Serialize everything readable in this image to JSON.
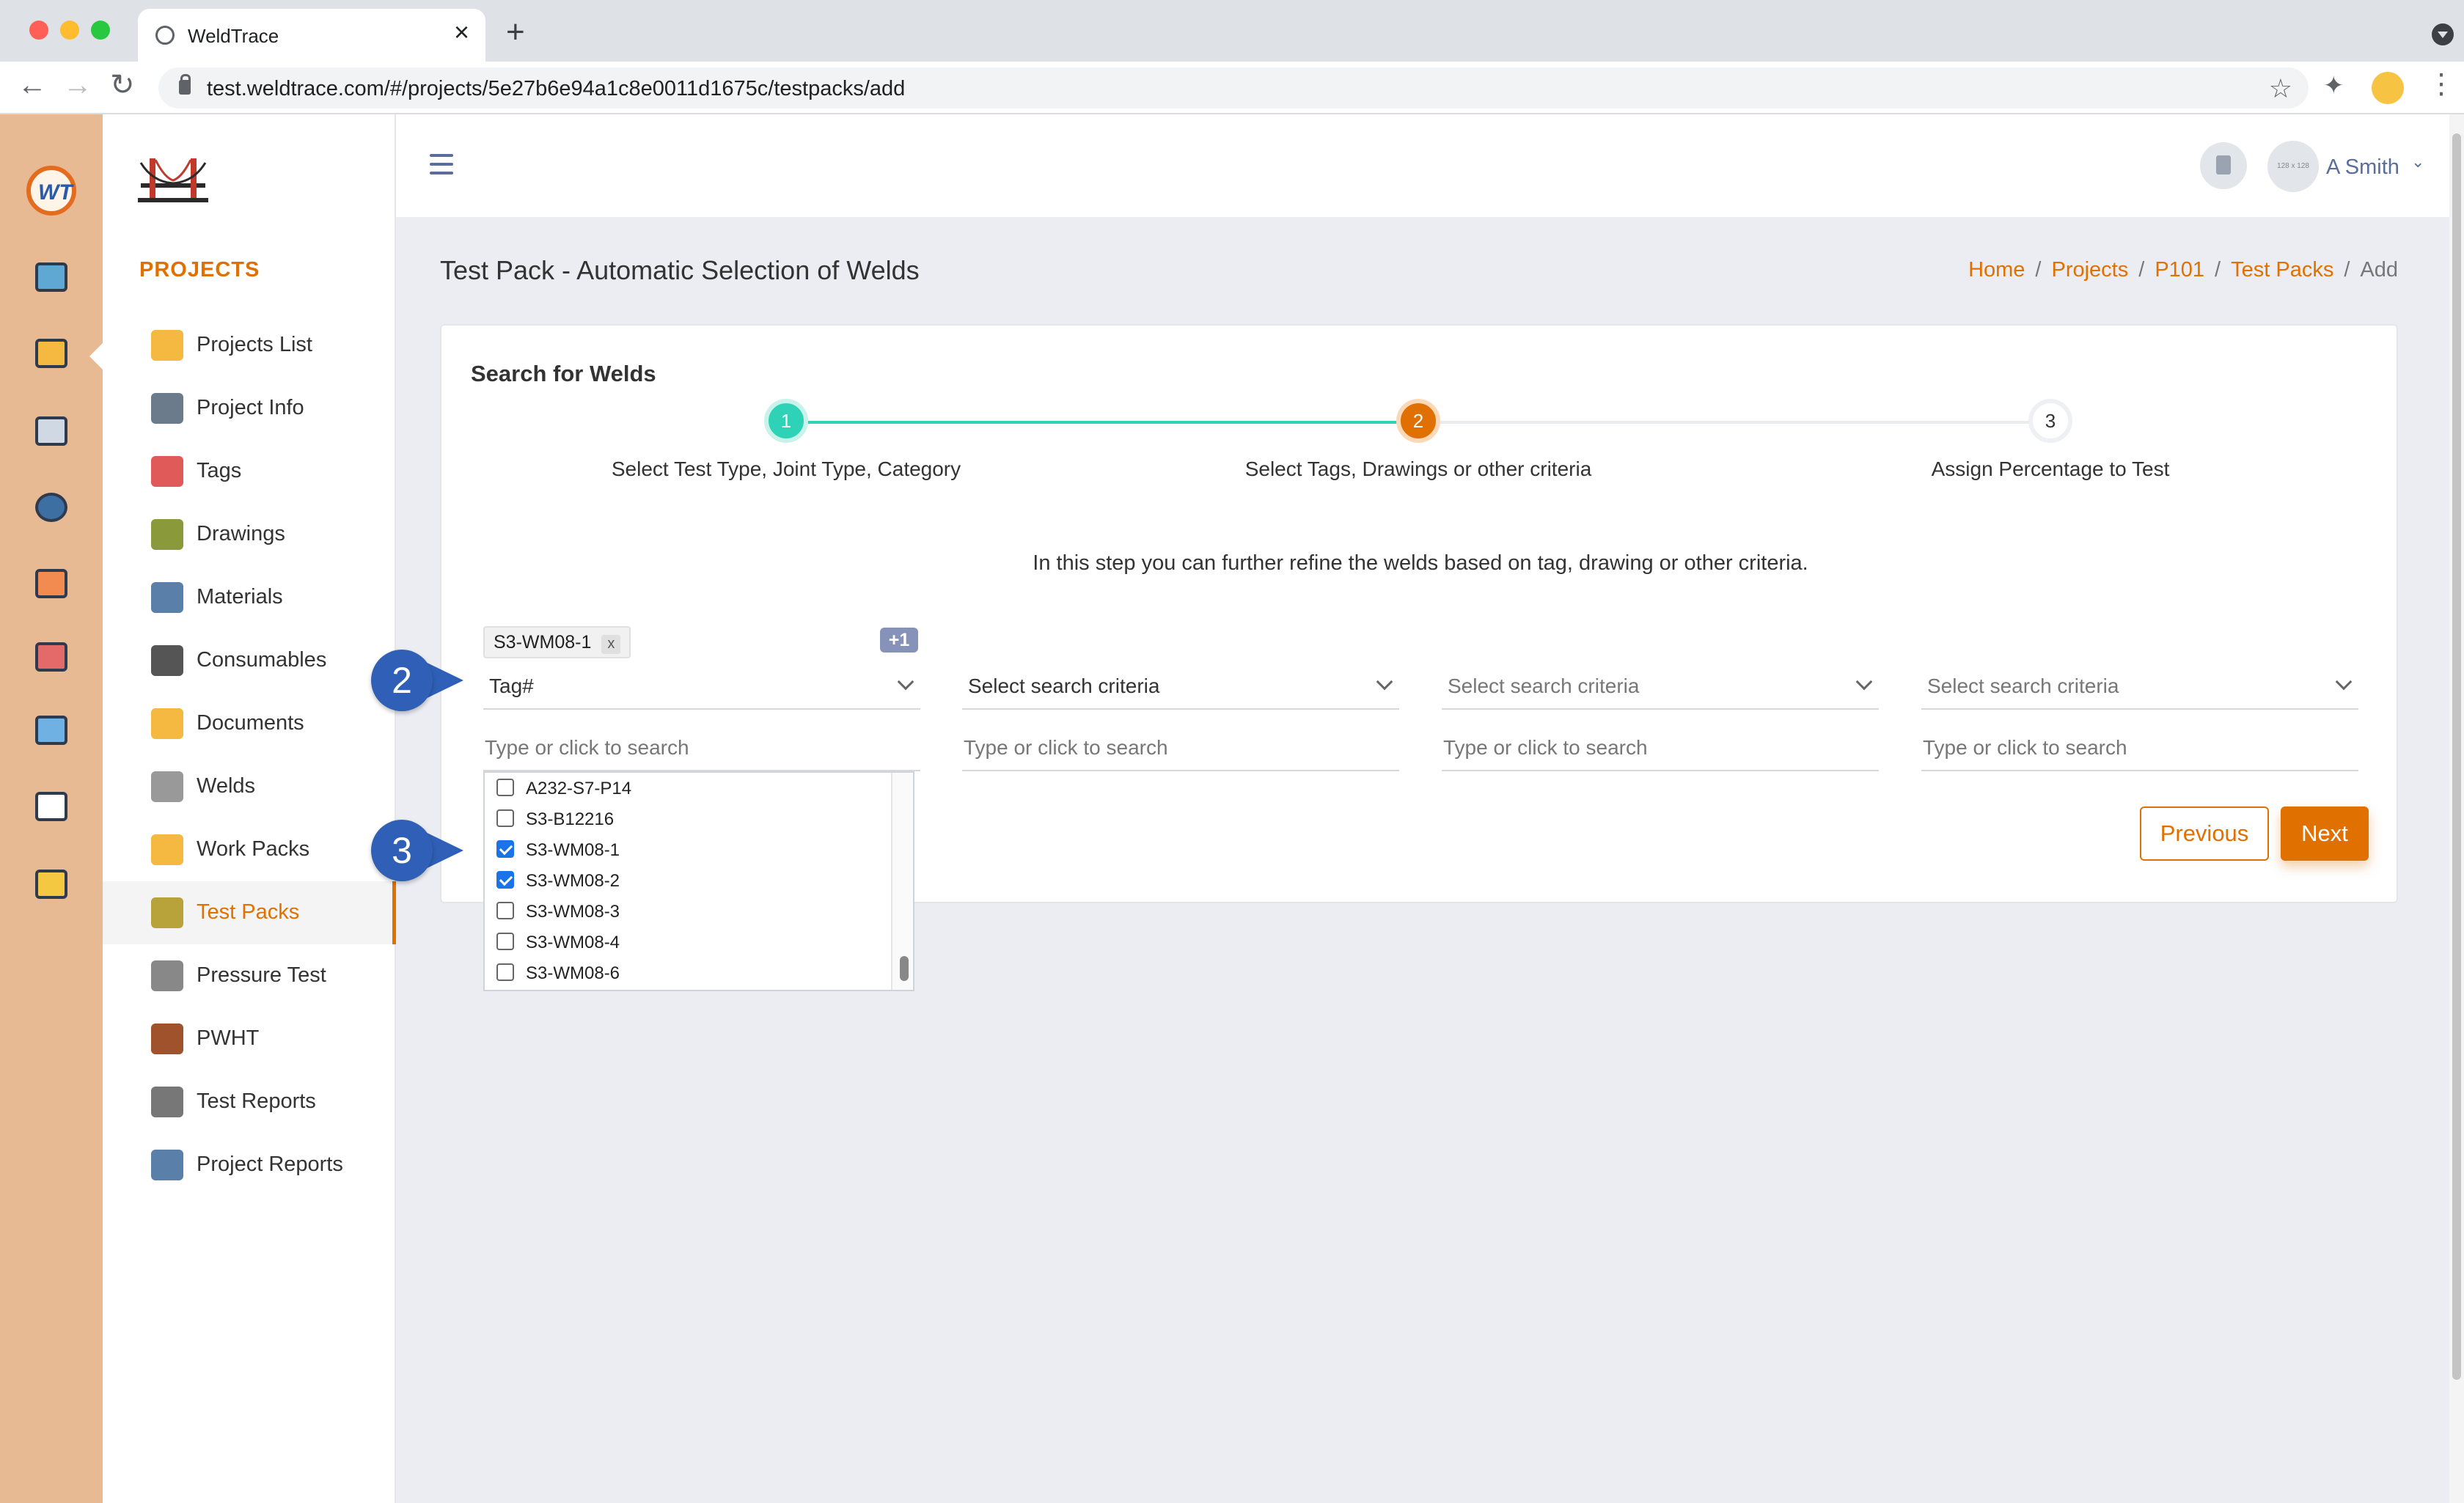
{
  "browser": {
    "tab_title": "WeldTrace",
    "url": "test.weldtrace.com/#/projects/5e27b6e94a1c8e0011d1675c/testpacks/add"
  },
  "rail": {
    "logo_text": "WT",
    "icons": [
      "dashboard-icon",
      "projects-folder-icon",
      "clipboard-icon",
      "welder-icon",
      "org-chart-icon",
      "monitor-chart-icon",
      "team-icon",
      "report-icon",
      "calculator-icon"
    ]
  },
  "sidebar": {
    "heading": "PROJECTS",
    "items": [
      {
        "label": "Projects List",
        "icon": "projects-list-icon"
      },
      {
        "label": "Project Info",
        "icon": "project-info-icon"
      },
      {
        "label": "Tags",
        "icon": "tag-icon"
      },
      {
        "label": "Drawings",
        "icon": "drawing-icon"
      },
      {
        "label": "Materials",
        "icon": "materials-icon"
      },
      {
        "label": "Consumables",
        "icon": "consumables-icon"
      },
      {
        "label": "Documents",
        "icon": "documents-icon"
      },
      {
        "label": "Welds",
        "icon": "weld-icon"
      },
      {
        "label": "Work Packs",
        "icon": "work-pack-icon"
      },
      {
        "label": "Test Packs",
        "icon": "test-pack-icon"
      },
      {
        "label": "Pressure Test",
        "icon": "pressure-gauge-icon"
      },
      {
        "label": "PWHT",
        "icon": "pwht-icon"
      },
      {
        "label": "Test Reports",
        "icon": "test-report-icon"
      },
      {
        "label": "Project Reports",
        "icon": "project-report-icon"
      }
    ],
    "active_index": 9
  },
  "header": {
    "avatar_text": "128 x 128",
    "user_name": "A Smith"
  },
  "page": {
    "title": "Test Pack - Automatic Selection of Welds",
    "breadcrumb": [
      "Home",
      "Projects",
      "P101",
      "Test Packs"
    ],
    "breadcrumb_current": "Add"
  },
  "card": {
    "title": "Search for Welds",
    "steps": [
      {
        "num": "1",
        "label": "Select Test Type, Joint Type, Category",
        "state": "complete"
      },
      {
        "num": "2",
        "label": "Select Tags, Drawings or other criteria",
        "state": "active"
      },
      {
        "num": "3",
        "label": "Assign Percentage to Test",
        "state": "pending"
      }
    ],
    "helper": "In this step you can further refine the welds based on tag, drawing or other criteria.",
    "chip": "S3-WM08-1",
    "chip_remove": "x",
    "more_badge": "+1",
    "criteria": [
      {
        "value": "Tag#",
        "placeholder": false,
        "search_placeholder": "Type or click to search"
      },
      {
        "value": "Select search criteria",
        "placeholder": false,
        "search_placeholder": "Type or click to search"
      },
      {
        "value": "Select search criteria",
        "placeholder": true,
        "search_placeholder": "Type or click to search"
      },
      {
        "value": "Select search criteria",
        "placeholder": true,
        "search_placeholder": "Type or click to search"
      }
    ],
    "dropdown_options": [
      {
        "label": "A232-S7-P14",
        "checked": false
      },
      {
        "label": "S3-B12216",
        "checked": false
      },
      {
        "label": "S3-WM08-1",
        "checked": true
      },
      {
        "label": "S3-WM08-2",
        "checked": true
      },
      {
        "label": "S3-WM08-3",
        "checked": false
      },
      {
        "label": "S3-WM08-4",
        "checked": false
      },
      {
        "label": "S3-WM08-6",
        "checked": false
      }
    ],
    "previous_label": "Previous",
    "next_label": "Next"
  },
  "callouts": [
    "2",
    "3"
  ],
  "colors": {
    "accent": "#e07000",
    "step_complete": "#2ed3b7",
    "rail": "#e8ba94",
    "callout": "#2f5fb6"
  }
}
